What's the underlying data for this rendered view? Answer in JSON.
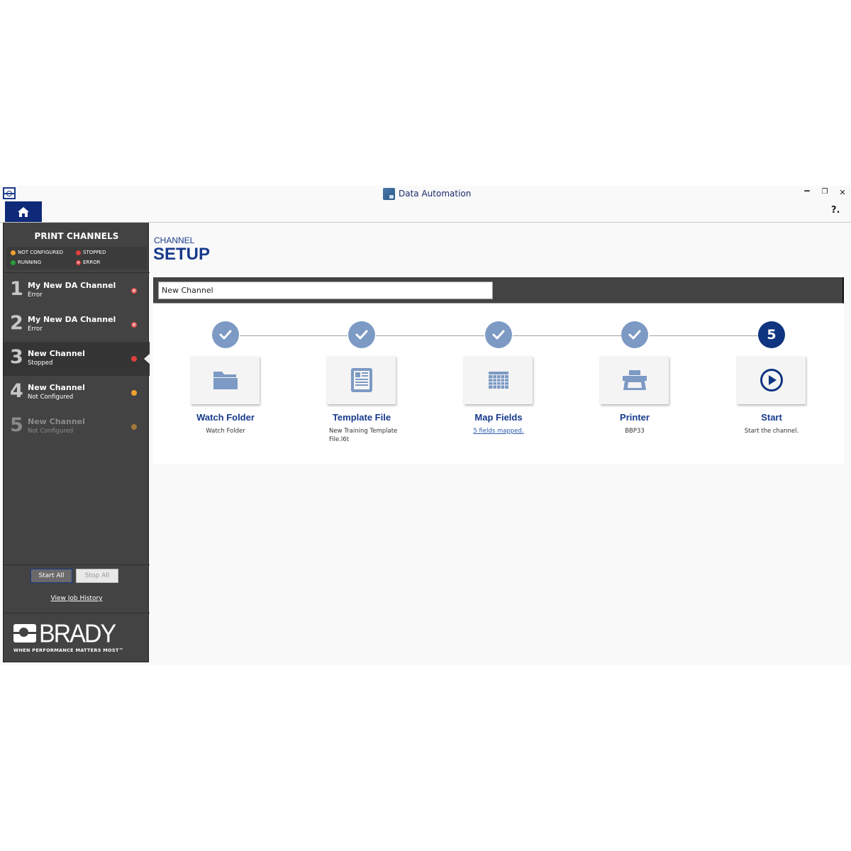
{
  "window": {
    "title": "Data Automation",
    "controls": {
      "minimize": "‒",
      "restore": "❐",
      "close": "✕"
    },
    "help_label": "?."
  },
  "sidebar": {
    "title": "PRINT CHANNELS",
    "legend": [
      {
        "label": "NOT CONFIGURED",
        "color": "#f0a030"
      },
      {
        "label": "STOPPED",
        "color": "#e04040"
      },
      {
        "label": "RUNNING",
        "color": "#2a9a3a"
      },
      {
        "label": "ERROR",
        "color": "#e04040"
      }
    ],
    "channels": [
      {
        "number": "1",
        "name": "My New DA Channel",
        "status": "Error",
        "indicator": "error",
        "color": "#e05050"
      },
      {
        "number": "2",
        "name": "My New DA Channel",
        "status": "Error",
        "indicator": "error",
        "color": "#e05050"
      },
      {
        "number": "3",
        "name": "New Channel",
        "status": "Stopped",
        "indicator": "stopped",
        "color": "#e04040",
        "selected": true
      },
      {
        "number": "4",
        "name": "New Channel",
        "status": "Not Configured",
        "indicator": "not-configured",
        "color": "#f0a030"
      },
      {
        "number": "5",
        "name": "New Channel",
        "status": "Not Configured",
        "indicator": "not-configured",
        "color": "#a07a3a",
        "disabled": true
      }
    ],
    "start_all": "Start All",
    "stop_all": "Stop All",
    "job_history": "View Job History",
    "brand": {
      "name": "BRADY",
      "tagline": "WHEN PERFORMANCE MATTERS MOST™"
    }
  },
  "main": {
    "subtitle": "CHANNEL",
    "title": "SETUP",
    "channel_name_value": "New Channel",
    "steps": [
      {
        "status": "complete",
        "badge": "✓",
        "icon": "folder-icon",
        "title": "Watch Folder",
        "description": "Watch Folder"
      },
      {
        "status": "complete",
        "badge": "✓",
        "icon": "template-icon",
        "title": "Template File",
        "description": "New Training Template File.l6t"
      },
      {
        "status": "complete",
        "badge": "✓",
        "icon": "table-grid-icon",
        "title": "Map Fields",
        "description": "5 fields mapped.",
        "description_is_link": true
      },
      {
        "status": "complete",
        "badge": "✓",
        "icon": "printer-icon",
        "title": "Printer",
        "description": "BBP33"
      },
      {
        "status": "current",
        "badge": "5",
        "icon": "play-circle-icon",
        "title": "Start",
        "description": "Start the channel."
      }
    ]
  },
  "colors": {
    "accent_navy": "#0f2a78",
    "step_complete": "#7c9ac4",
    "step_current": "#0f3480",
    "sidebar_bg": "#434343"
  }
}
